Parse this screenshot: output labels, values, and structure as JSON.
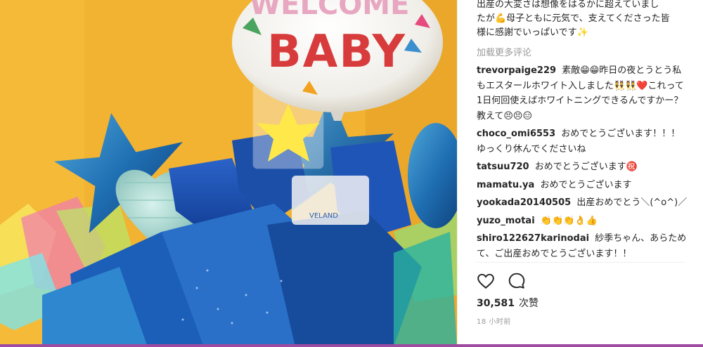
{
  "photo": {
    "balloon_text_top": "WELCOME",
    "balloon_text_main": "BABY",
    "bag_label": "VELAND"
  },
  "caption": {
    "line1": "出産の大変さは想像をはるかに超えていまし",
    "line2": "たが💪母子ともに元気で、支えてくださった皆",
    "line3": "様に感謝でいっぱいです✨"
  },
  "load_more": "加载更多评论",
  "comments": [
    {
      "user": "trevorpaige229",
      "text": "素敵😁😁昨日の夜とうとう私もエスタールホワイト入しました👯👯❤️これって1日何回使えばホワイトニングできるんですかー？ 教えて😣😣😑"
    },
    {
      "user": "choco_omi6553",
      "text": "おめでとうございます！！！ ゆっくり休んでくださいね"
    },
    {
      "user": "tatsuu720",
      "text": "おめでとうございます㊗️"
    },
    {
      "user": "mamatu.ya",
      "text": "おめでとうございます"
    },
    {
      "user": "yookada20140505",
      "text": "出産おめでとう＼(^o^)／"
    },
    {
      "user": "yuzo_motai",
      "text": "👏👏👏👌👍"
    },
    {
      "user": "shiro122627karinodai",
      "text": "紗季ちゃん、あらためて、ご出産おめでとうございます！！"
    }
  ],
  "likes": {
    "count": "30,581",
    "label": "次赞"
  },
  "timestamp": "18 小时前",
  "colors": {
    "accent_bar": "#a04ba2",
    "background": "#f3b030"
  },
  "icons": {
    "like": "heart-icon",
    "comment": "comment-bubble-icon"
  }
}
